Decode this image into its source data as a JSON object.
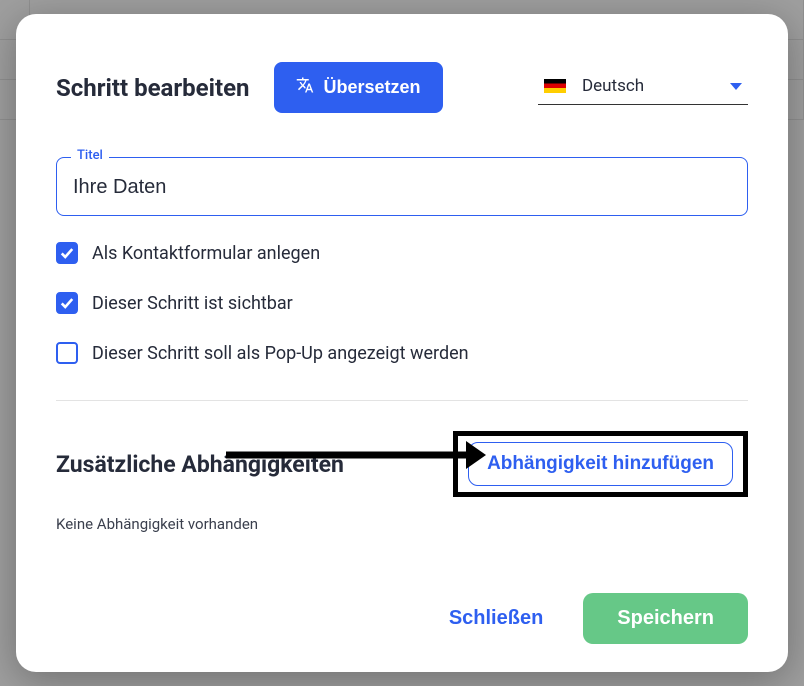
{
  "header": {
    "title": "Schritt bearbeiten",
    "translate_label": "Übersetzen",
    "language_name": "Deutsch"
  },
  "title_field": {
    "legend": "Titel",
    "value": "Ihre Daten"
  },
  "checkboxes": {
    "as_contact_form": {
      "label": "Als Kontaktformular anlegen",
      "checked": true
    },
    "step_visible": {
      "label": "Dieser Schritt ist sichtbar",
      "checked": true
    },
    "show_as_popup": {
      "label": "Dieser Schritt soll als Pop-Up angezeigt werden",
      "checked": false
    }
  },
  "dependencies": {
    "heading": "Zusätzliche Abhängigkeiten",
    "add_button": "Abhängigkeit hinzufügen",
    "empty_text": "Keine Abhängigkeit vorhanden"
  },
  "footer": {
    "close": "Schließen",
    "save": "Speichern"
  }
}
